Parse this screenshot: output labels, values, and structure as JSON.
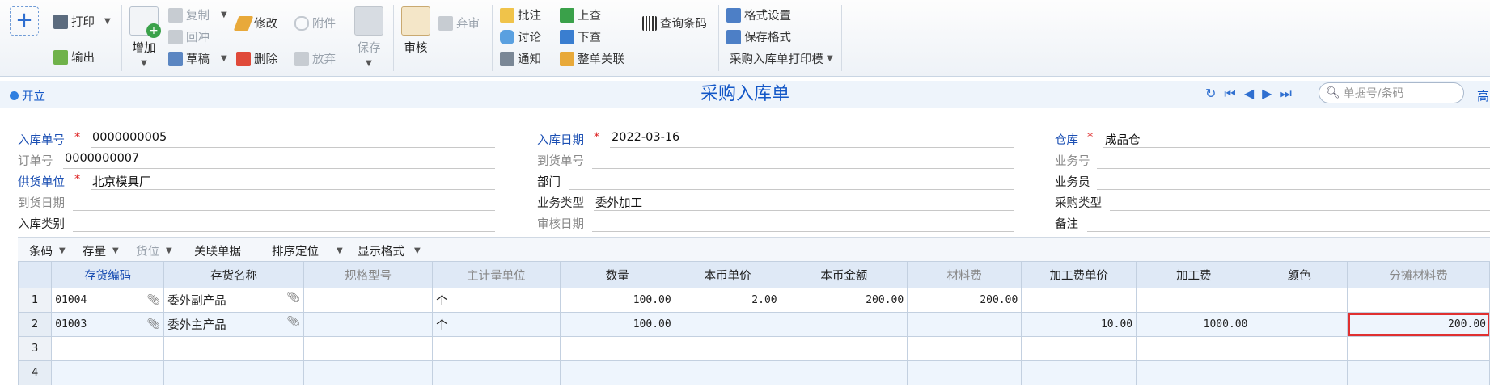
{
  "toolbar": {
    "new_label": "+",
    "print": "打印",
    "export": "输出",
    "add": "增加",
    "copy": "复制",
    "return": "回冲",
    "draft": "草稿",
    "modify": "修改",
    "delete": "删除",
    "attachment": "附件",
    "abandon": "放弃",
    "save": "保存",
    "review": "审核",
    "discard_review": "弃审",
    "annotate": "批注",
    "discuss": "讨论",
    "notify": "通知",
    "prev_check": "上查",
    "next_check": "下查",
    "link_all": "整单关联",
    "barcode_query": "查询条码",
    "format_settings": "格式设置",
    "save_format": "保存格式",
    "print_template": "采购入库单打印模"
  },
  "header": {
    "status": "开立",
    "title": "采购入库单",
    "search_placeholder": "单据号/条码",
    "more": "高"
  },
  "form": {
    "inbound_no_label": "入库单号",
    "inbound_no": "0000000005",
    "order_no_label": "订单号",
    "order_no": "0000000007",
    "supplier_label": "供货单位",
    "supplier": "北京模具厂",
    "arrival_date_label": "到货日期",
    "inbound_type_label": "入库类别",
    "inbound_date_label": "入库日期",
    "inbound_date": "2022-03-16",
    "arrival_no_label": "到货单号",
    "dept_label": "部门",
    "biz_type_label": "业务类型",
    "biz_type": "委外加工",
    "review_date_label": "审核日期",
    "warehouse_label": "仓库",
    "warehouse": "成品仓",
    "biz_no_label": "业务号",
    "salesman_label": "业务员",
    "purchase_type_label": "采购类型",
    "remark_label": "备注",
    "required_mark": "*"
  },
  "gridbar": {
    "barcode": "条码",
    "stock": "存量",
    "location": "货位",
    "linked_docs": "关联单据",
    "sort_locate": "排序定位",
    "display_format": "显示格式"
  },
  "table": {
    "columns": [
      "存货编码",
      "存货名称",
      "规格型号",
      "主计量单位",
      "数量",
      "本币单价",
      "本币金额",
      "材料费",
      "加工费单价",
      "加工费",
      "颜色",
      "分摊材料费"
    ],
    "rows": [
      {
        "n": "1",
        "code": "01004",
        "name": "委外副产品",
        "spec": "",
        "unit": "个",
        "qty": "100.00",
        "price": "2.00",
        "amount": "200.00",
        "material": "200.00",
        "proc_price": "",
        "proc_fee": "",
        "color": "",
        "alloc": ""
      },
      {
        "n": "2",
        "code": "01003",
        "name": "委外主产品",
        "spec": "",
        "unit": "个",
        "qty": "100.00",
        "price": "",
        "amount": "",
        "material": "",
        "proc_price": "10.00",
        "proc_fee": "1000.00",
        "color": "",
        "alloc": "200.00"
      },
      {
        "n": "3",
        "code": "",
        "name": "",
        "spec": "",
        "unit": "",
        "qty": "",
        "price": "",
        "amount": "",
        "material": "",
        "proc_price": "",
        "proc_fee": "",
        "color": "",
        "alloc": ""
      },
      {
        "n": "4",
        "code": "",
        "name": "",
        "spec": "",
        "unit": "",
        "qty": "",
        "price": "",
        "amount": "",
        "material": "",
        "proc_price": "",
        "proc_fee": "",
        "color": "",
        "alloc": ""
      }
    ],
    "attachment_icon": "paperclip-icon"
  },
  "colors": {
    "accent": "#1357c7",
    "highlight": "#e03030",
    "header_bg": "#dfe9f6"
  }
}
